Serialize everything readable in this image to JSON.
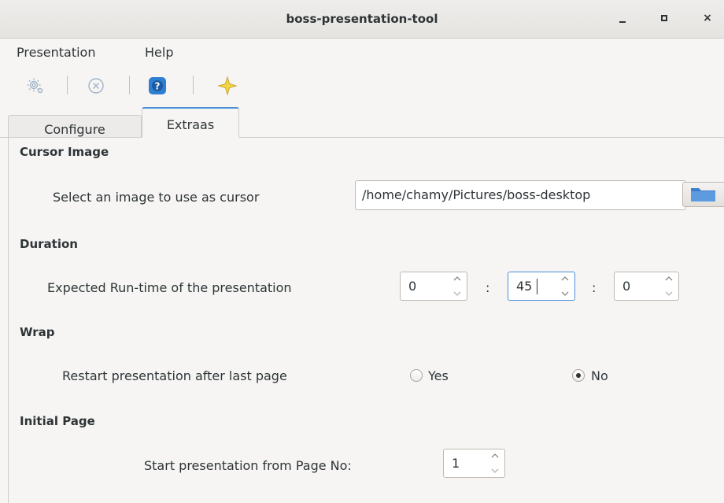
{
  "window": {
    "title": "boss-presentation-tool",
    "controls": {
      "minimize": "-",
      "maximize": "▫",
      "close": "×"
    }
  },
  "menubar": {
    "items": [
      {
        "label": "Presentation"
      },
      {
        "label": "Help"
      }
    ]
  },
  "toolbar": {
    "items": [
      {
        "icon": "settings-icon"
      },
      {
        "icon": "stop-icon"
      },
      {
        "icon": "help-icon"
      },
      {
        "icon": "star-icon"
      }
    ]
  },
  "tabs": [
    {
      "label": "Configure",
      "active": false
    },
    {
      "label": "Extraas",
      "active": true
    }
  ],
  "cursor_image": {
    "title": "Cursor Image",
    "label": "Select an image to use as cursor",
    "path": "/home/chamy/Pictures/boss-desktop"
  },
  "duration": {
    "title": "Duration",
    "label": "Expected Run-time of the presentation",
    "hours": "0",
    "minutes": "45",
    "seconds": "0",
    "separator": ":"
  },
  "wrap": {
    "title": "Wrap",
    "label": "Restart presentation after last page",
    "option_yes": "Yes",
    "option_no": "No",
    "selected": "No"
  },
  "initial_page": {
    "title": "Initial Page",
    "label": "Start presentation from Page No:",
    "value": "1"
  },
  "colors": {
    "accent": "#4a90d9",
    "background": "#f6f5f4",
    "border": "#cfcbc6"
  }
}
